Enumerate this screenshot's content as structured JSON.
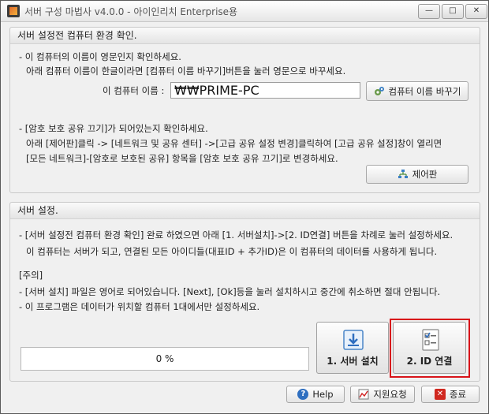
{
  "window": {
    "title": "서버 구성 마법사 v4.0.0 - 아이인리치 Enterprise용",
    "controls": {
      "minimize": "—",
      "maximize": "□",
      "close": "✕"
    }
  },
  "check_section": {
    "title": "서버 설정전 컴퓨터 환경 확인.",
    "line1": "- 이 컴퓨터의 이름이 영문인지 확인하세요.",
    "line2": "아래 컴퓨터 이름이 한글이라면 [컴퓨터 이름 바꾸기]버튼을 눌러 영문으로 바꾸세요.",
    "computer_name_label": "이 컴퓨터 이름 :",
    "computer_name_value": "₩₩PRIME-PC",
    "rename_button": "컴퓨터 이름 바꾸기",
    "line3": "- [암호 보호 공유 끄기]가 되어있는지 확인하세요.",
    "line4": "아래 [제어판]클릭 -> [네트워크 및 공유 센터] ->[고급 공유 설정 변경]클릭하여 [고급 공유 설정]창이 열리면",
    "line5": "[모든 네트워크]-[암호로 보호된 공유] 항목을 [암호 보호 공유 끄기]로 변경하세요.",
    "control_panel_button": "제어판"
  },
  "server_section": {
    "title": "서버 설정.",
    "line1": "- [서버 설정전 컴퓨터 환경 확인] 완료 하였으면 아래 [1. 서버설치]->[2. ID연결] 버튼을 차례로 눌러 설정하세요.",
    "line2": "이 컴퓨터는 서버가 되고, 연결된 모든 아이디들(대표ID + 추가ID)은 이 컴퓨터의 데이터를 사용하게 됩니다.",
    "note_title": "[주의]",
    "note1": "- [서버 설치] 파일은 영어로 되어있습니다. [Next], [Ok]등을 눌러 설치하시고 중간에 취소하면 절대 안됩니다.",
    "note2": "- 이 프로그램은 데이터가 위치할 컴퓨터 1대에서만 설정하세요.",
    "progress_text": "0 %",
    "progress_value": 0,
    "install_button": "1. 서버 설치",
    "connect_button": "2. ID 연결"
  },
  "footer": {
    "help": "Help",
    "support": "지원요청",
    "exit": "종료"
  },
  "colors": {
    "highlight": "#d8141a",
    "accent": "#2f6fc0"
  }
}
